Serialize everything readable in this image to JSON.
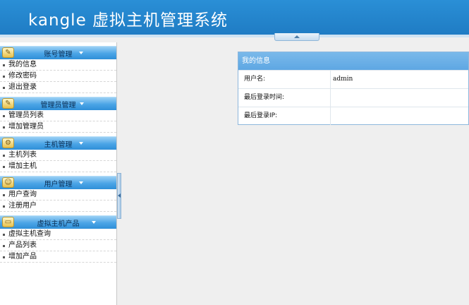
{
  "header": {
    "title": "kangle 虚拟主机管理系统"
  },
  "sidebar": {
    "groups": [
      {
        "label": "账号管理",
        "icon": "folder-icon",
        "items": [
          "我的信息",
          "修改密码",
          "退出登录"
        ]
      },
      {
        "label": "管理员管理",
        "icon": "folder-icon",
        "items": [
          "管理员列表",
          "增加管理员"
        ]
      },
      {
        "label": "主机管理",
        "icon": "server-icon",
        "items": [
          "主机列表",
          "增加主机"
        ]
      },
      {
        "label": "用户管理",
        "icon": "users-icon",
        "items": [
          "用户查询",
          "注册用户"
        ]
      },
      {
        "label": "虚拟主机产品",
        "icon": "monitor-icon",
        "items": [
          "虚拟主机查询",
          "产品列表",
          "增加产品"
        ]
      }
    ]
  },
  "info_panel": {
    "title": "我的信息",
    "rows": [
      {
        "label": "用户名:",
        "value": "admin"
      },
      {
        "label": "最后登录时间:",
        "value": ""
      },
      {
        "label": "最后登录IP:",
        "value": ""
      }
    ]
  },
  "colors": {
    "header_bg": "#1f7cc4",
    "group_header_bg": "#4aa4e6",
    "panel_header_bg": "#6aaee6"
  }
}
